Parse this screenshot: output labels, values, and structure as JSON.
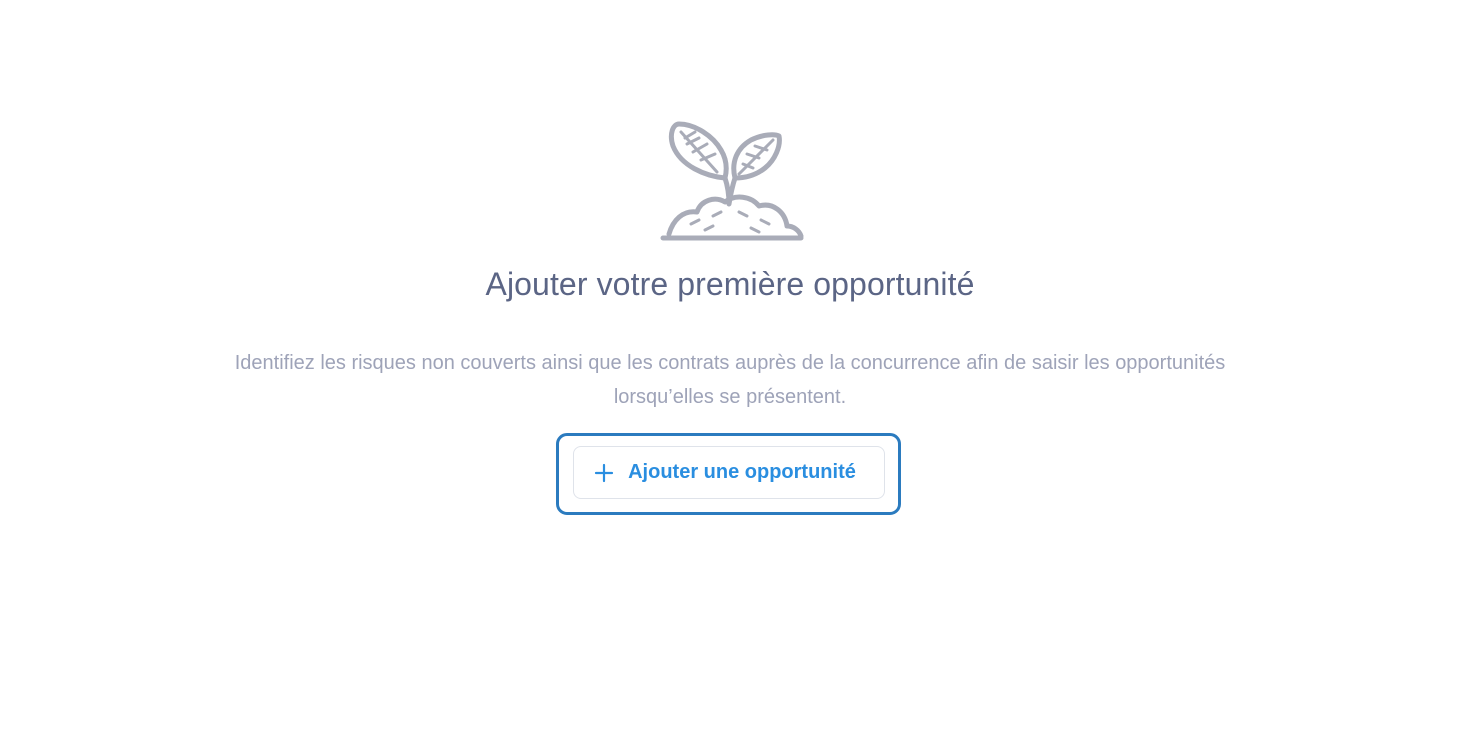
{
  "empty_state": {
    "illustration_icon": "sprout-icon",
    "title": "Ajouter votre première opportunité",
    "description": "Identifiez les risques non couverts ainsi que les contrats auprès de la concurrence afin de saisir les opportunités lorsqu’elles se présentent.",
    "add_button": {
      "icon": "plus-icon",
      "label": "Ajouter une opportunité"
    }
  },
  "colors": {
    "title": "#5b6585",
    "description": "#9ea3b8",
    "button_text": "#2a8ee0",
    "highlight_frame": "#2b7bbf",
    "illustration": "#a9acb8"
  }
}
